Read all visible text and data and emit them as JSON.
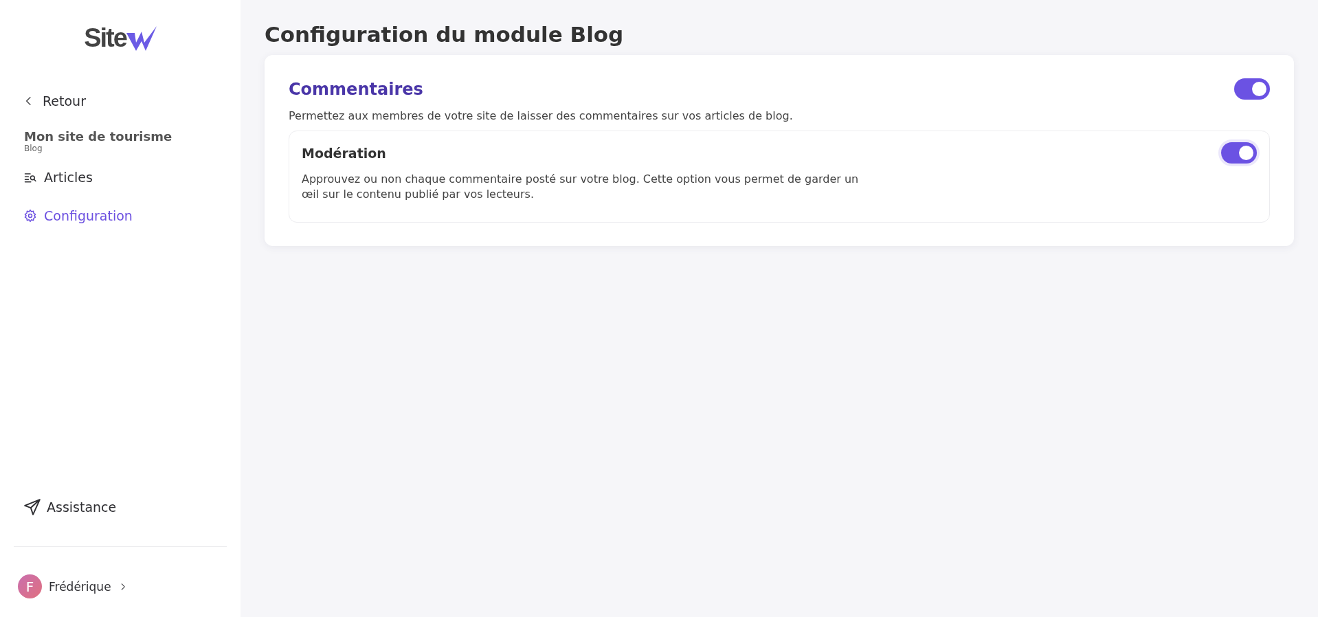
{
  "logo": {
    "text": "Site"
  },
  "sidebar": {
    "back": "Retour",
    "site": {
      "name": "Mon site de tourisme",
      "module": "Blog"
    },
    "items": [
      {
        "kind": "articles",
        "label": "Articles",
        "selected": false
      },
      {
        "kind": "settings",
        "label": "Configuration",
        "selected": true
      }
    ],
    "help": "Assistance",
    "user": {
      "initial": "F",
      "name": "Frédérique"
    }
  },
  "page": {
    "title": "Configuration du module Blog"
  },
  "section": {
    "title": "Commentaires",
    "on": true,
    "description": "Permettez aux membres de votre site de laisser des commentaires sur vos articles de blog.",
    "options": [
      {
        "title": "Modération",
        "on": true,
        "focused": true,
        "description": "Approuvez ou non chaque commentaire posté sur votre blog. Cette option vous permet de garder un œil sur le contenu publié par vos lecteurs."
      }
    ]
  }
}
